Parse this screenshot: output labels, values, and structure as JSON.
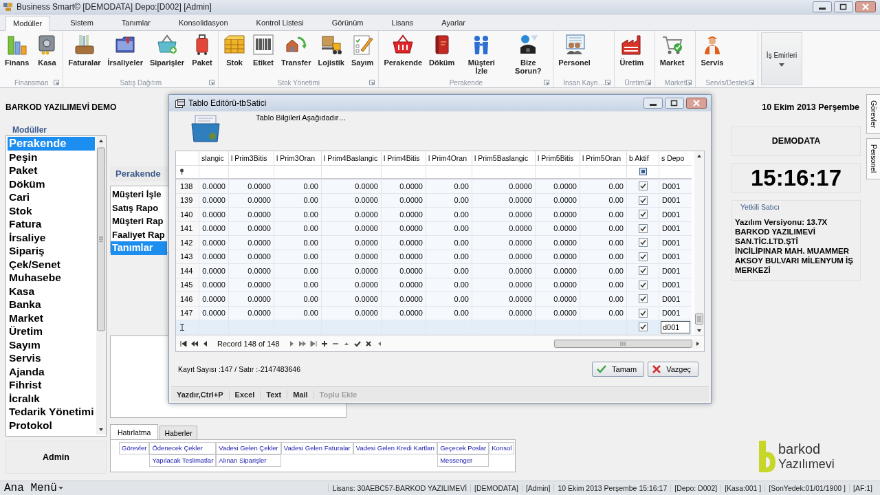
{
  "window": {
    "title": "Business Smart© [DEMODATA] Depo:[D002] [Admin]"
  },
  "ribbon_tabs": [
    {
      "label": "Modüller",
      "selected": true
    },
    {
      "label": "Sistem",
      "selected": false
    },
    {
      "label": "Tanımlar",
      "selected": false
    },
    {
      "label": "Konsolidasyon",
      "selected": false
    },
    {
      "label": "Kontrol Listesi",
      "selected": false
    },
    {
      "label": "Görünüm",
      "selected": false
    },
    {
      "label": "Lisans",
      "selected": false
    },
    {
      "label": "Ayarlar",
      "selected": false
    }
  ],
  "ribbon_groups": [
    {
      "label": "Finansman",
      "buttons": [
        {
          "label": "Finans"
        },
        {
          "label": "Kasa"
        }
      ]
    },
    {
      "label": "Satış Dağıtım",
      "buttons": [
        {
          "label": "Faturalar"
        },
        {
          "label": "İrsaliyeler"
        },
        {
          "label": "Siparişler"
        },
        {
          "label": "Paket"
        }
      ]
    },
    {
      "label": "Stok Yönetimi",
      "buttons": [
        {
          "label": "Stok"
        },
        {
          "label": "Etiket"
        },
        {
          "label": "Transfer"
        },
        {
          "label": "Lojistik"
        },
        {
          "label": "Sayım"
        }
      ]
    },
    {
      "label": "Perakende",
      "buttons": [
        {
          "label": "Perakende"
        },
        {
          "label": "Döküm"
        },
        {
          "label": "Müşteri İzle"
        },
        {
          "label": "Bize Sorun?"
        }
      ]
    },
    {
      "label": "İnsan Kayn…",
      "buttons": [
        {
          "label": "Personel"
        }
      ]
    },
    {
      "label": "Üretim",
      "buttons": [
        {
          "label": "Üretim"
        }
      ]
    },
    {
      "label": "Market",
      "buttons": [
        {
          "label": "Market"
        }
      ]
    },
    {
      "label": "Servis/Destek",
      "buttons": [
        {
          "label": "Servis"
        }
      ]
    }
  ],
  "ribbon_dropdown": {
    "label": "İş Emirleri"
  },
  "company_header": "BARKOD YAZILIMEVİ DEMO",
  "date_header": "10 Ekim 2013 Perşembe",
  "modules": {
    "title": "Modüller",
    "items": [
      {
        "label": "Perakende",
        "selected": true
      },
      {
        "label": "Peşin",
        "selected": false
      },
      {
        "label": "Paket",
        "selected": false
      },
      {
        "label": "Döküm",
        "selected": false
      },
      {
        "label": "Cari",
        "selected": false
      },
      {
        "label": "Stok",
        "selected": false
      },
      {
        "label": "Fatura",
        "selected": false
      },
      {
        "label": "İrsaliye",
        "selected": false
      },
      {
        "label": "Sipariş",
        "selected": false
      },
      {
        "label": "Çek/Senet",
        "selected": false
      },
      {
        "label": "Muhasebe",
        "selected": false
      },
      {
        "label": "Kasa",
        "selected": false
      },
      {
        "label": "Banka",
        "selected": false
      },
      {
        "label": "Market",
        "selected": false
      },
      {
        "label": "Üretim",
        "selected": false
      },
      {
        "label": "Sayım",
        "selected": false
      },
      {
        "label": "Servis",
        "selected": false
      },
      {
        "label": "Ajanda",
        "selected": false
      },
      {
        "label": "Fihrist",
        "selected": false
      },
      {
        "label": "İcralık",
        "selected": false
      },
      {
        "label": "Tedarik Yönetimi",
        "selected": false
      },
      {
        "label": "Protokol",
        "selected": false
      }
    ]
  },
  "user": "Admin",
  "sub_panel": {
    "title": "Perakende",
    "items": [
      {
        "label": "Müşteri İşle",
        "selected": false
      },
      {
        "label": "Satış Rapo",
        "selected": false
      },
      {
        "label": "Müşteri Rap",
        "selected": false
      },
      {
        "label": "Faaliyet Rap",
        "selected": false
      },
      {
        "label": "Tanımlar",
        "selected": true
      }
    ]
  },
  "reminder_tabs": [
    {
      "label": "Hatırlatma",
      "selected": true
    },
    {
      "label": "Haberler",
      "selected": false
    }
  ],
  "reminder_links": [
    [
      {
        "label": "Görevler"
      },
      {
        "label": "Ödenecek Çekler"
      },
      {
        "label": "Vadesi Gelen Çekler"
      },
      {
        "label": "Vadesi Gelen Faturalar"
      },
      {
        "label": "Vadesi Gelen Kredi Kartları"
      },
      {
        "label": "Geçecek Poslar"
      },
      {
        "label": "Konsol"
      }
    ],
    [
      {
        "label": "Yapılacak Teslimatlar"
      },
      {
        "label": "Alınan Siparişler"
      },
      {
        "label": "Messenger"
      }
    ]
  ],
  "right_panel": {
    "database": "DEMODATA",
    "clock": "15:16:17",
    "dealer": {
      "title": "Yetkili Satıcı",
      "lines": [
        "Yazılım Versiyonu: 13.7X",
        "BARKOD YAZILIMEVİ",
        "SAN.TİC.LTD.ŞTİ",
        "İNCİLİPINAR MAH. MUAMMER AKSOY BULVARI MİLENYUM İŞ MERKEZİ"
      ]
    }
  },
  "side_tabs": [
    {
      "label": "Görevler"
    },
    {
      "label": "Personel"
    }
  ],
  "logo": {
    "line_1": "barkod",
    "line_2": "Yazılımevi"
  },
  "status_bar": {
    "menu": "Ana Menü",
    "items": [
      "Lisans: 30AEBC57-BARKOD YAZILIMEVİ",
      "[DEMODATA]",
      "[Admin]",
      "10 Ekim 2013 Perşembe 15:16:17",
      "[Depo: D002]",
      "[Kasa:001 ]",
      "[SonYedek:01/01/1900 ]",
      "[AF:1]"
    ]
  },
  "dialog": {
    "title": "Tablo Editörü-tbSatici",
    "subtitle": "Tablo Bilgileri Aşağıdadır…",
    "columns": [
      "slangic",
      "l Prim3Bitis",
      "l Prim3Oran",
      "l Prim4Baslangic",
      "l Prim4Bitis",
      "l Prim4Oran",
      "l Prim5Baslangic",
      "l Prim5Bitis",
      "l Prim5Oran",
      "b Aktif",
      "s Depo"
    ],
    "rows": [
      {
        "id": "138",
        "values": [
          "0.0000",
          "0.0000",
          "0.00",
          "0.0000",
          "0.0000",
          "0.00",
          "0.0000",
          "0.0000",
          "0.00"
        ],
        "aktif": true,
        "depo": "D001"
      },
      {
        "id": "139",
        "values": [
          "0.0000",
          "0.0000",
          "0.00",
          "0.0000",
          "0.0000",
          "0.00",
          "0.0000",
          "0.0000",
          "0.00"
        ],
        "aktif": true,
        "depo": "D001"
      },
      {
        "id": "140",
        "values": [
          "0.0000",
          "0.0000",
          "0.00",
          "0.0000",
          "0.0000",
          "0.00",
          "0.0000",
          "0.0000",
          "0.00"
        ],
        "aktif": true,
        "depo": "D001"
      },
      {
        "id": "141",
        "values": [
          "0.0000",
          "0.0000",
          "0.00",
          "0.0000",
          "0.0000",
          "0.00",
          "0.0000",
          "0.0000",
          "0.00"
        ],
        "aktif": true,
        "depo": "D001"
      },
      {
        "id": "142",
        "values": [
          "0.0000",
          "0.0000",
          "0.00",
          "0.0000",
          "0.0000",
          "0.00",
          "0.0000",
          "0.0000",
          "0.00"
        ],
        "aktif": true,
        "depo": "D001"
      },
      {
        "id": "143",
        "values": [
          "0.0000",
          "0.0000",
          "0.00",
          "0.0000",
          "0.0000",
          "0.00",
          "0.0000",
          "0.0000",
          "0.00"
        ],
        "aktif": true,
        "depo": "D001"
      },
      {
        "id": "144",
        "values": [
          "0.0000",
          "0.0000",
          "0.00",
          "0.0000",
          "0.0000",
          "0.00",
          "0.0000",
          "0.0000",
          "0.00"
        ],
        "aktif": true,
        "depo": "D001"
      },
      {
        "id": "145",
        "values": [
          "0.0000",
          "0.0000",
          "0.00",
          "0.0000",
          "0.0000",
          "0.00",
          "0.0000",
          "0.0000",
          "0.00"
        ],
        "aktif": true,
        "depo": "D001"
      },
      {
        "id": "146",
        "values": [
          "0.0000",
          "0.0000",
          "0.00",
          "0.0000",
          "0.0000",
          "0.00",
          "0.0000",
          "0.0000",
          "0.00"
        ],
        "aktif": true,
        "depo": "D001"
      },
      {
        "id": "147",
        "values": [
          "0.0000",
          "0.0000",
          "0.00",
          "0.0000",
          "0.0000",
          "0.00",
          "0.0000",
          "0.0000",
          "0.00"
        ],
        "aktif": true,
        "depo": "D001"
      }
    ],
    "new_row": {
      "aktif": true,
      "depo": "d001"
    },
    "record": "Record 148 of 148",
    "count": "Kayıt Sayısı :147 / Satır :-2147483646",
    "buttons": [
      {
        "label": "Tamam",
        "kind": "ok"
      },
      {
        "label": "Vazgeç",
        "kind": "cancel"
      }
    ],
    "actions": [
      {
        "label": "Yazdır,Ctrl+P",
        "disabled": false
      },
      {
        "label": "Excel",
        "disabled": false
      },
      {
        "label": "Text",
        "disabled": false
      },
      {
        "label": "Mail",
        "disabled": false
      },
      {
        "label": "Toplu Ekle",
        "disabled": true
      }
    ]
  }
}
